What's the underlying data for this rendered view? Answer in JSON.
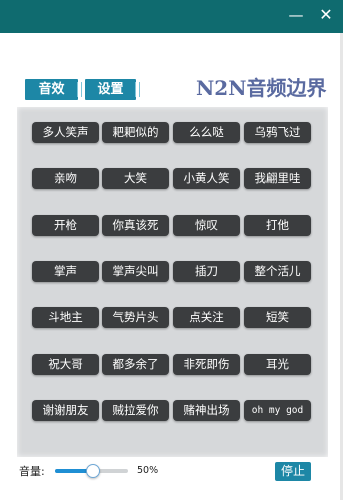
{
  "window": {
    "minimize_glyph": "—",
    "close_glyph": "✕"
  },
  "tabs": [
    {
      "label": "音效"
    },
    {
      "label": "设置"
    }
  ],
  "brand": "N2N音频边界",
  "sound_buttons": [
    "多人笑声",
    "耙耙似的",
    "么么哒",
    "乌鸦飞过",
    "亲吻",
    "大笑",
    "小黄人笑",
    "我翩里哇",
    "开枪",
    "你真该死",
    "惊叹",
    "打他",
    "掌声",
    "掌声尖叫",
    "插刀",
    "整个活儿",
    "斗地主",
    "气势片头",
    "点关注",
    "短笑",
    "祝大哥",
    "都多余了",
    "非死即伤",
    "耳光",
    "谢谢朋友",
    "贼拉爱你",
    "赌神出场",
    "oh my god"
  ],
  "volume": {
    "label": "音量:",
    "value_text": "50%",
    "level_fraction": 0.5
  },
  "stop_button": "停止",
  "colors": {
    "titlebar": "#0f6b6f",
    "accent": "#1d87a6",
    "sound_button_bg": "#3b3d3f",
    "brand_text": "#5a6aa0"
  }
}
